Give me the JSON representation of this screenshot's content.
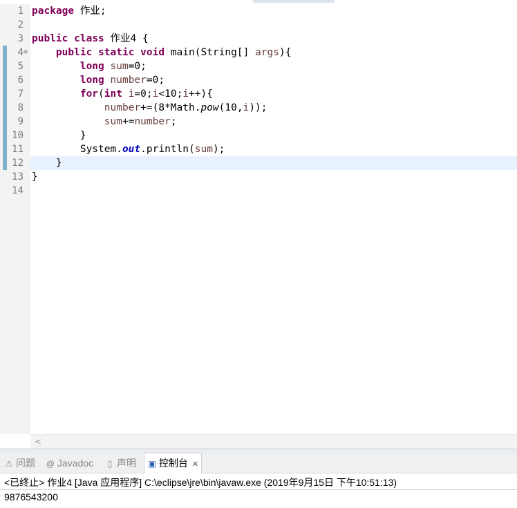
{
  "editor": {
    "line_numbers": [
      "1",
      "2",
      "3",
      "4",
      "5",
      "6",
      "7",
      "8",
      "9",
      "10",
      "11",
      "12",
      "13",
      "14"
    ],
    "fold_marker": "⊖",
    "lines": [
      [
        {
          "t": "package",
          "c": "kw"
        },
        {
          "t": " 作业;"
        }
      ],
      [],
      [
        {
          "t": "public",
          "c": "kw"
        },
        {
          "t": " "
        },
        {
          "t": "class",
          "c": "kw"
        },
        {
          "t": " 作业4 {"
        }
      ],
      [
        {
          "t": "    "
        },
        {
          "t": "public",
          "c": "kw"
        },
        {
          "t": " "
        },
        {
          "t": "static",
          "c": "kw"
        },
        {
          "t": " "
        },
        {
          "t": "void",
          "c": "kw"
        },
        {
          "t": " main(String[] "
        },
        {
          "t": "args",
          "c": "var"
        },
        {
          "t": "){"
        }
      ],
      [
        {
          "t": "        "
        },
        {
          "t": "long",
          "c": "kw"
        },
        {
          "t": " "
        },
        {
          "t": "sum",
          "c": "var"
        },
        {
          "t": "=0;"
        }
      ],
      [
        {
          "t": "        "
        },
        {
          "t": "long",
          "c": "kw"
        },
        {
          "t": " "
        },
        {
          "t": "number",
          "c": "var"
        },
        {
          "t": "=0;"
        }
      ],
      [
        {
          "t": "        "
        },
        {
          "t": "for",
          "c": "kw"
        },
        {
          "t": "("
        },
        {
          "t": "int",
          "c": "kw"
        },
        {
          "t": " "
        },
        {
          "t": "i",
          "c": "var"
        },
        {
          "t": "=0;"
        },
        {
          "t": "i",
          "c": "var"
        },
        {
          "t": "<10;"
        },
        {
          "t": "i",
          "c": "var"
        },
        {
          "t": "++){"
        }
      ],
      [
        {
          "t": "            "
        },
        {
          "t": "number",
          "c": "var"
        },
        {
          "t": "+=(8*Math."
        },
        {
          "t": "pow",
          "c": "mth"
        },
        {
          "t": "(10,"
        },
        {
          "t": "i",
          "c": "var"
        },
        {
          "t": "));"
        }
      ],
      [
        {
          "t": "            "
        },
        {
          "t": "sum",
          "c": "var"
        },
        {
          "t": "+="
        },
        {
          "t": "number",
          "c": "var"
        },
        {
          "t": ";"
        }
      ],
      [
        {
          "t": "        }"
        }
      ],
      [
        {
          "t": "        System."
        },
        {
          "t": "out",
          "c": "fld"
        },
        {
          "t": ".println("
        },
        {
          "t": "sum",
          "c": "var"
        },
        {
          "t": ");"
        }
      ],
      [
        {
          "t": "    }"
        }
      ],
      [
        {
          "t": "}"
        }
      ],
      []
    ]
  },
  "scroll_arrow": "<",
  "tabs": [
    {
      "label": "问题",
      "icon": "⚠"
    },
    {
      "label": "Javadoc",
      "icon": "@"
    },
    {
      "label": "声明",
      "icon": "▯"
    },
    {
      "label": "控制台",
      "icon": "▣",
      "close": "✕"
    }
  ],
  "console": {
    "header": "<已终止> 作业4 [Java 应用程序] C:\\eclipse\\jre\\bin\\javaw.exe  (2019年9月15日 下午10:51:13)",
    "output": "9876543200"
  }
}
